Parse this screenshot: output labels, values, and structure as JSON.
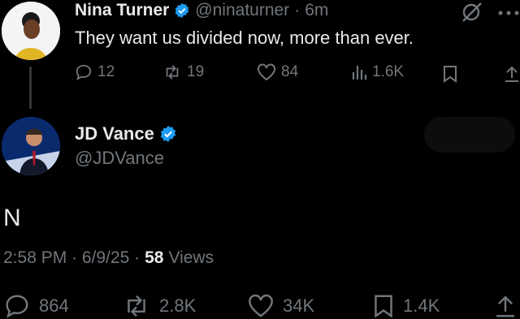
{
  "quoted": {
    "name": "Nina Turner",
    "handle": "@ninaturner",
    "separator": "·",
    "time": "6m",
    "text": "They want us divided now, more than ever.",
    "stats": {
      "replies": "12",
      "reposts": "19",
      "likes": "84",
      "views": "1.6K"
    }
  },
  "reply": {
    "name": "JD Vance",
    "handle": "@JDVance",
    "text": "N",
    "timestamp": "2:58 PM · 6/9/25 ·",
    "views_count": "58",
    "views_label": "Views",
    "stats": {
      "replies": "864",
      "reposts": "2.8K",
      "likes": "34K",
      "bookmarks": "1.4K"
    }
  },
  "colors": {
    "verified": "#1d9bf0",
    "muted": "#71767b",
    "text": "#e7e9ea",
    "background": "#000000"
  }
}
